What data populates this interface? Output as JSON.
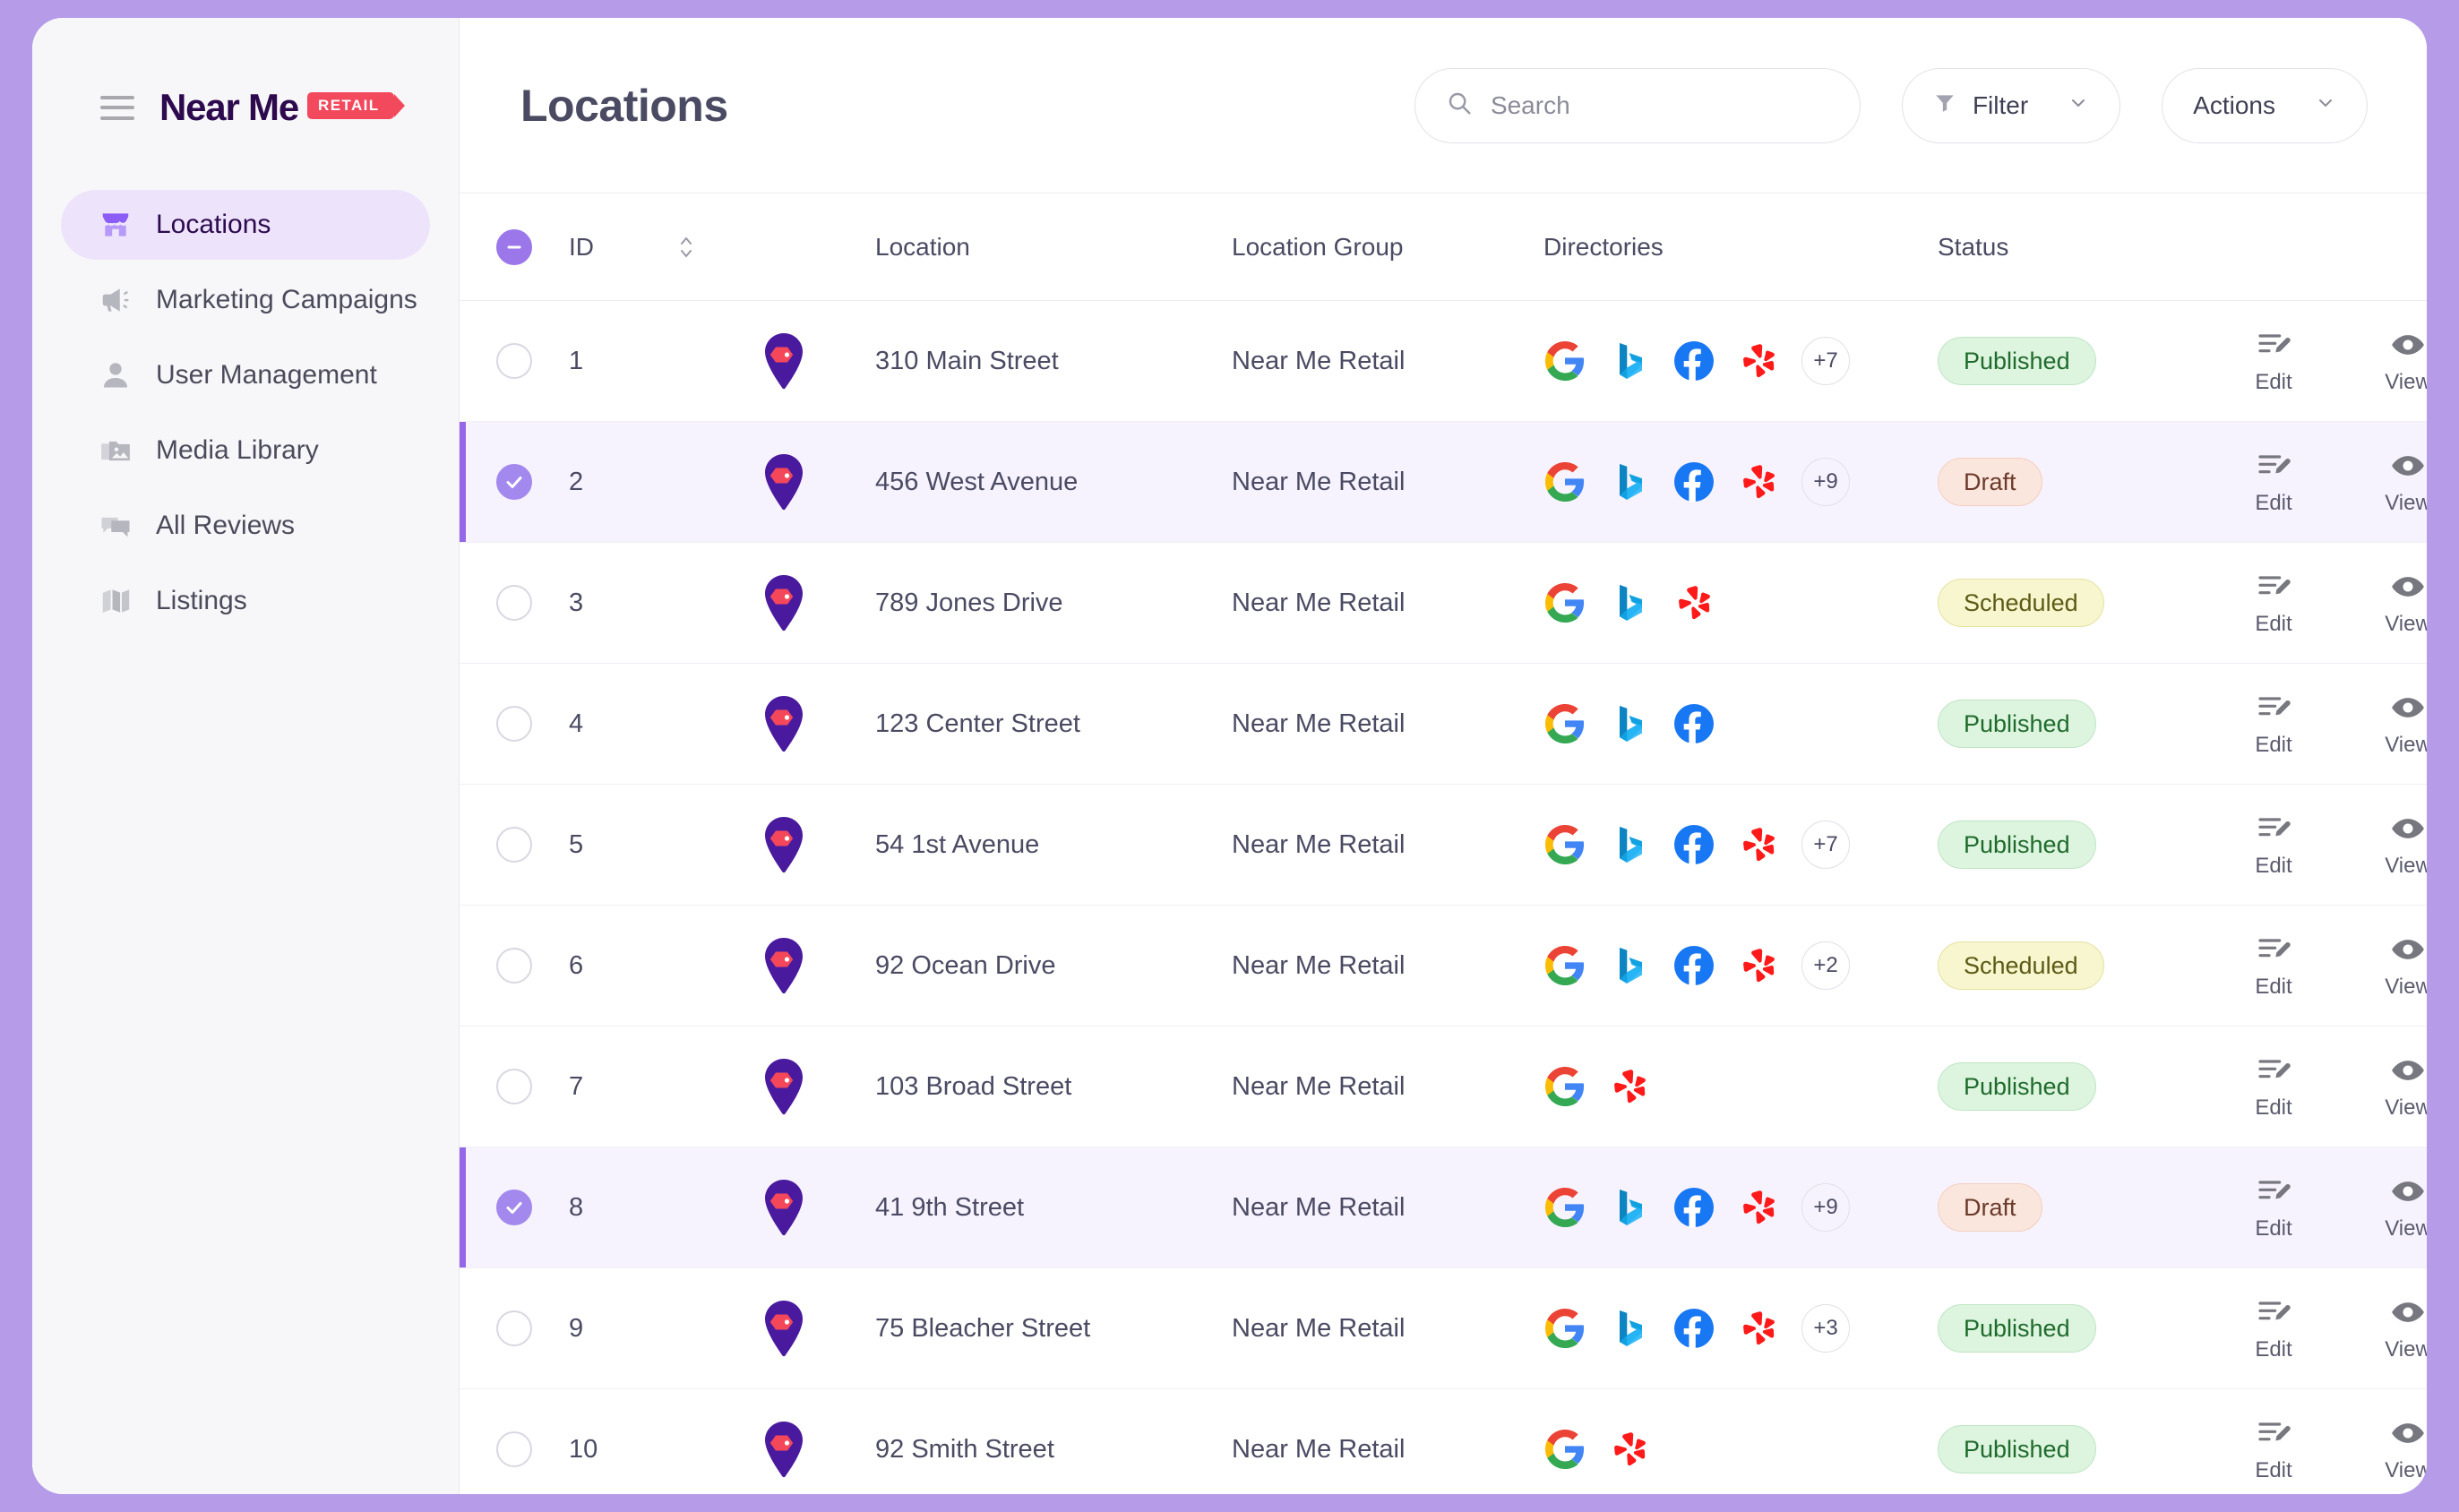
{
  "theme": {
    "frame_color": "#b69ce8",
    "accent": "#9466e8",
    "sidebar_bg": "#f7f7f9",
    "selected_row_bg": "#f7f3fe"
  },
  "sidebar": {
    "brand_name": "Near Me",
    "brand_tag": "RETAIL",
    "menu_icon": "hamburger-icon",
    "items": [
      {
        "label": "Locations",
        "icon": "storefront-icon",
        "active": true
      },
      {
        "label": "Marketing Campaigns",
        "icon": "megaphone-icon",
        "active": false
      },
      {
        "label": "User Management",
        "icon": "person-icon",
        "active": false
      },
      {
        "label": "Media Library",
        "icon": "photo-folder-icon",
        "active": false
      },
      {
        "label": "All Reviews",
        "icon": "chat-bubbles-icon",
        "active": false
      },
      {
        "label": "Listings",
        "icon": "map-icon",
        "active": false
      }
    ]
  },
  "header": {
    "title": "Locations",
    "search": {
      "placeholder": "Search",
      "value": "",
      "icon": "search-icon"
    },
    "filter": {
      "label": "Filter",
      "icon": "funnel-icon",
      "chevron": "chevron-down-icon"
    },
    "actions": {
      "label": "Actions",
      "chevron": "chevron-down-icon"
    }
  },
  "table": {
    "select_all_state": "indeterminate",
    "columns": {
      "id": "ID",
      "location": "Location",
      "location_group": "Location Group",
      "directories": "Directories",
      "status": "Status"
    },
    "sort_icon": "sort-arrows-icon",
    "row_actions": {
      "edit_label": "Edit",
      "edit_icon": "edit-lines-pencil-icon",
      "view_label": "View",
      "view_icon": "eye-icon"
    },
    "rows": [
      {
        "id": "1",
        "location": "310 Main Street",
        "group": "Near Me Retail",
        "directories": [
          "google",
          "bing",
          "facebook",
          "yelp"
        ],
        "more": "+7",
        "status": "Published",
        "status_type": "published",
        "selected": false
      },
      {
        "id": "2",
        "location": "456 West Avenue",
        "group": "Near Me Retail",
        "directories": [
          "google",
          "bing",
          "facebook",
          "yelp"
        ],
        "more": "+9",
        "status": "Draft",
        "status_type": "draft",
        "selected": true
      },
      {
        "id": "3",
        "location": "789 Jones Drive",
        "group": "Near Me Retail",
        "directories": [
          "google",
          "bing",
          "yelp"
        ],
        "more": "",
        "status": "Scheduled",
        "status_type": "scheduled",
        "selected": false
      },
      {
        "id": "4",
        "location": "123 Center Street",
        "group": "Near Me Retail",
        "directories": [
          "google",
          "bing",
          "facebook"
        ],
        "more": "",
        "status": "Published",
        "status_type": "published",
        "selected": false
      },
      {
        "id": "5",
        "location": "54 1st Avenue",
        "group": "Near Me Retail",
        "directories": [
          "google",
          "bing",
          "facebook",
          "yelp"
        ],
        "more": "+7",
        "status": "Published",
        "status_type": "published",
        "selected": false
      },
      {
        "id": "6",
        "location": "92 Ocean Drive",
        "group": "Near Me Retail",
        "directories": [
          "google",
          "bing",
          "facebook",
          "yelp"
        ],
        "more": "+2",
        "status": "Scheduled",
        "status_type": "scheduled",
        "selected": false
      },
      {
        "id": "7",
        "location": "103 Broad Street",
        "group": "Near Me Retail",
        "directories": [
          "google",
          "yelp"
        ],
        "more": "",
        "status": "Published",
        "status_type": "published",
        "selected": false
      },
      {
        "id": "8",
        "location": "41 9th Street",
        "group": "Near Me Retail",
        "directories": [
          "google",
          "bing",
          "facebook",
          "yelp"
        ],
        "more": "+9",
        "status": "Draft",
        "status_type": "draft",
        "selected": true
      },
      {
        "id": "9",
        "location": "75 Bleacher Street",
        "group": "Near Me Retail",
        "directories": [
          "google",
          "bing",
          "facebook",
          "yelp"
        ],
        "more": "+3",
        "status": "Published",
        "status_type": "published",
        "selected": false
      },
      {
        "id": "10",
        "location": "92 Smith Street",
        "group": "Near Me Retail",
        "directories": [
          "google",
          "yelp"
        ],
        "more": "",
        "status": "Published",
        "status_type": "published",
        "selected": false
      }
    ]
  }
}
